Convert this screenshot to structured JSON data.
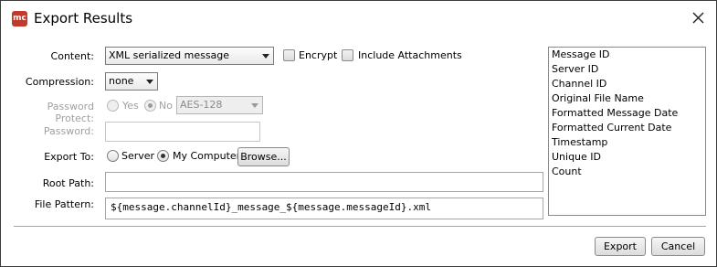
{
  "window": {
    "title": "Export Results",
    "app_icon_text": "mc",
    "close_icon": "close-icon"
  },
  "form": {
    "content": {
      "label": "Content:",
      "selected": "XML serialized message",
      "encrypt_label": "Encrypt",
      "include_attachments_label": "Include Attachments"
    },
    "compression": {
      "label": "Compression:",
      "selected": "none"
    },
    "password_protect": {
      "label": "Password Protect:",
      "yes_label": "Yes",
      "no_label": "No",
      "selected": "No",
      "algorithm": "AES-128"
    },
    "password": {
      "label": "Password:",
      "value": ""
    },
    "export_to": {
      "label": "Export To:",
      "server_label": "Server",
      "my_computer_label": "My Computer",
      "selected": "My Computer",
      "browse_label": "Browse..."
    },
    "root_path": {
      "label": "Root Path:",
      "value": ""
    },
    "file_pattern": {
      "label": "File Pattern:",
      "value": "${message.channelId}_message_${message.messageId}.xml"
    }
  },
  "variables": [
    "Message ID",
    "Server ID",
    "Channel ID",
    "Original File Name",
    "Formatted Message Date",
    "Formatted Current Date",
    "Timestamp",
    "Unique ID",
    "Count"
  ],
  "footer": {
    "export_label": "Export",
    "cancel_label": "Cancel"
  }
}
